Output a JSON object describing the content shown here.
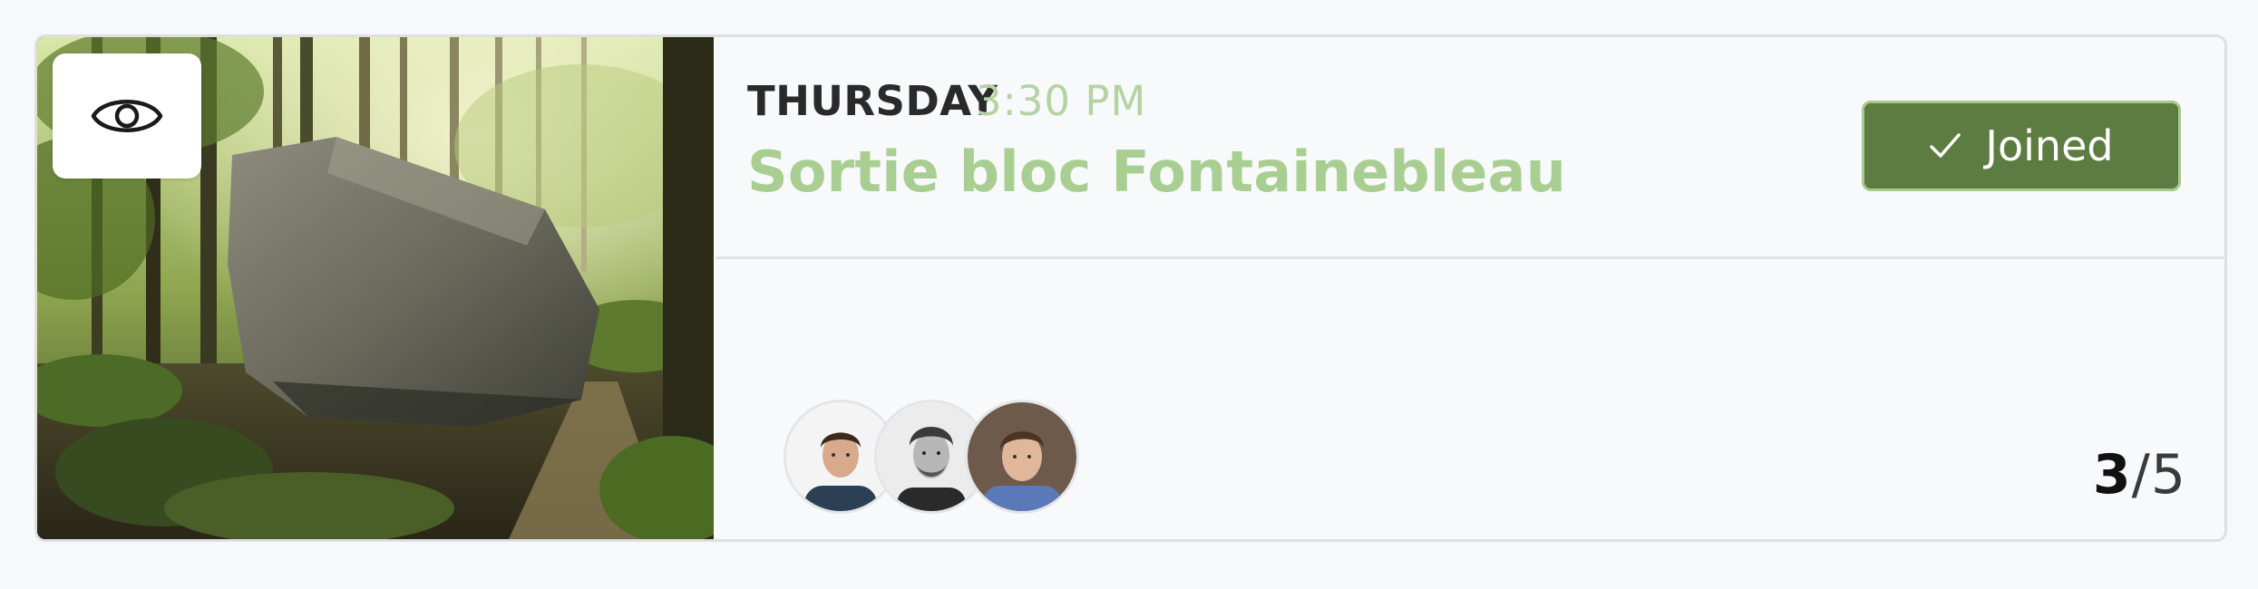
{
  "event": {
    "day": "THURSDAY",
    "time": "3:30 PM",
    "title": "Sortie bloc Fontainebleau"
  },
  "actions": {
    "joined_label": "Joined",
    "joined_icon": "check-icon",
    "view_icon": "eye-icon"
  },
  "participants": {
    "avatars": [
      "avatar-1",
      "avatar-2",
      "avatar-3"
    ],
    "current": "3",
    "separator": "/",
    "max": "5"
  },
  "colors": {
    "accent_green": "#5d7c41",
    "title_green": "#a9ce92",
    "time_green": "#b5d3a2"
  }
}
